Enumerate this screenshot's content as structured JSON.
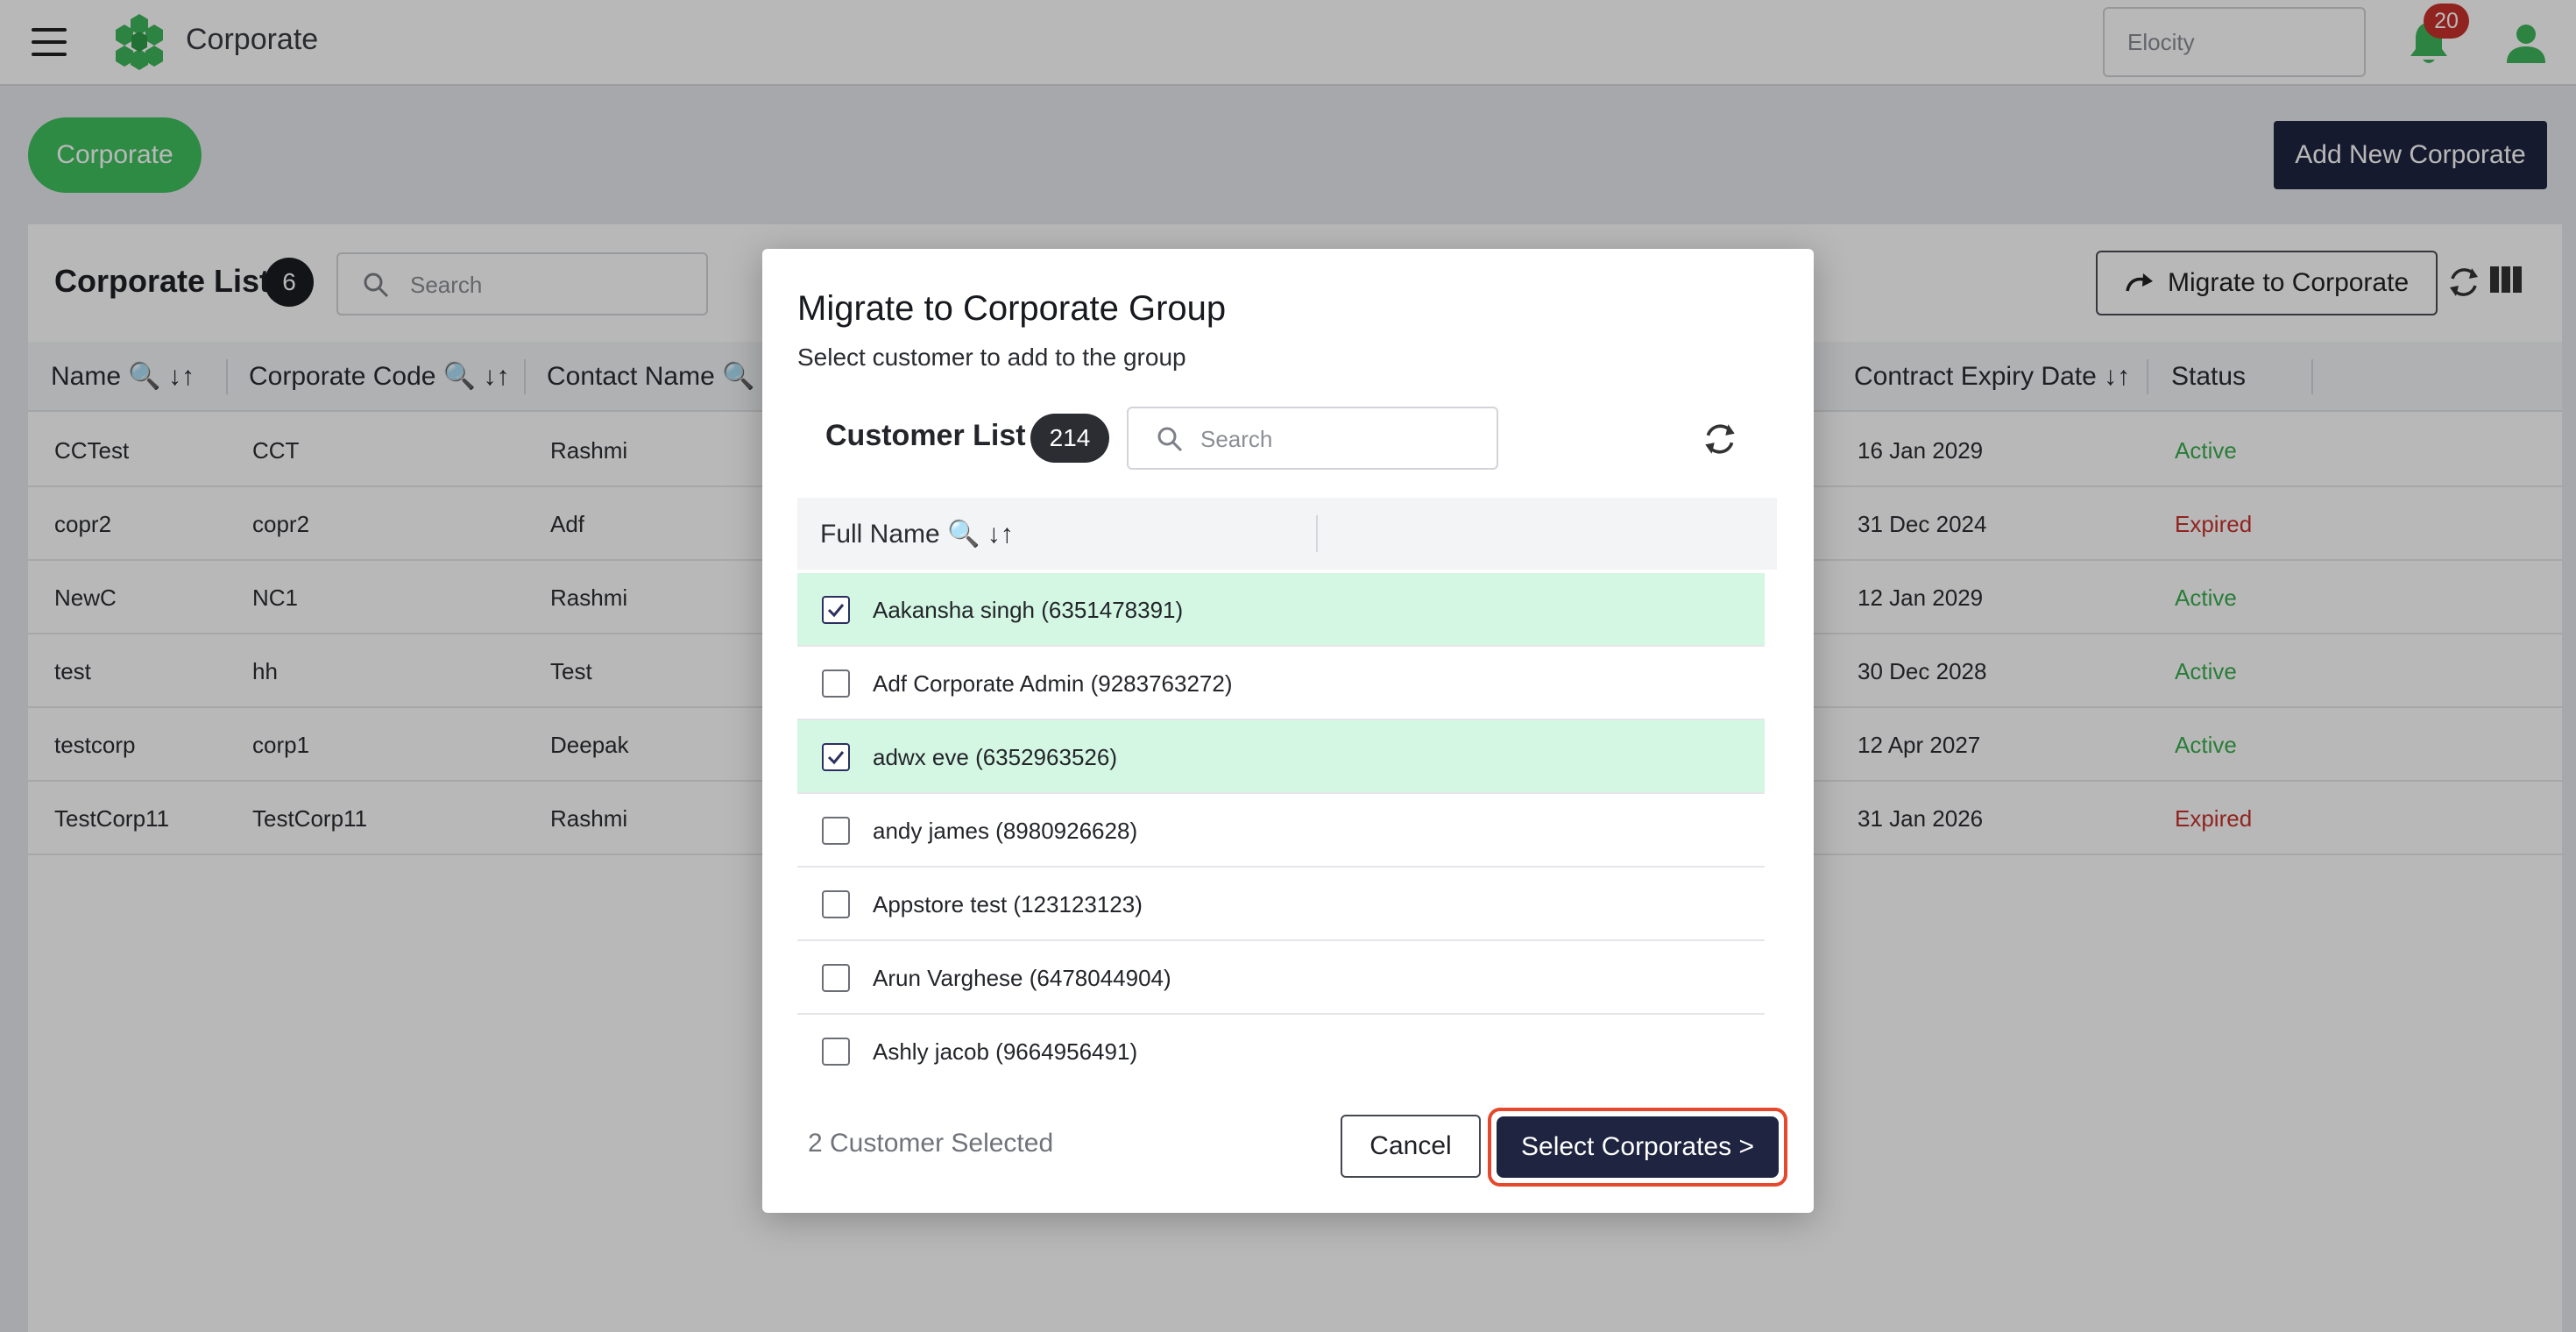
{
  "topbar": {
    "app_title": "Corporate",
    "tenant": "Elocity",
    "notification_count": "20"
  },
  "header": {
    "pill_label": "Corporate",
    "add_button": "Add New Corporate"
  },
  "corporate_list": {
    "title": "Corporate List",
    "count": "6",
    "search_placeholder": "Search",
    "migrate_button": "Migrate to Corporate",
    "columns": [
      "Name 🔍 ↓↑",
      "Corporate Code 🔍 ↓↑",
      "Contact Name 🔍 ↓↑",
      "Contract Expiry Date ↓↑",
      "Status"
    ],
    "rows": [
      {
        "name": "CCTest",
        "code": "CCT",
        "contact": "Rashmi",
        "expiry": "16 Jan 2029",
        "status": "Active"
      },
      {
        "name": "copr2",
        "code": "copr2",
        "contact": "Adf",
        "expiry": "31 Dec 2024",
        "status": "Expired"
      },
      {
        "name": "NewC",
        "code": "NC1",
        "contact": "Rashmi",
        "expiry": "12 Jan 2029",
        "status": "Active"
      },
      {
        "name": "test",
        "code": "hh",
        "contact": "Test",
        "expiry": "30 Dec 2028",
        "status": "Active"
      },
      {
        "name": "testcorp",
        "code": "corp1",
        "contact": "Deepak",
        "expiry": "12 Apr 2027",
        "status": "Active"
      },
      {
        "name": "TestCorp11",
        "code": "TestCorp11",
        "contact": "Rashmi",
        "expiry": "31 Jan 2026",
        "status": "Expired"
      }
    ]
  },
  "modal": {
    "title": "Migrate to Corporate Group",
    "subtitle": "Select customer to add to the group",
    "customer_list_title": "Customer List",
    "customer_count": "214",
    "search_placeholder": "Search",
    "column_header": "Full Name 🔍 ↓↑",
    "customers": [
      {
        "label": "Aakansha singh (6351478391)",
        "checked": true
      },
      {
        "label": "Adf Corporate Admin (9283763272)",
        "checked": false
      },
      {
        "label": "adwx eve (6352963526)",
        "checked": true
      },
      {
        "label": "andy james (8980926628)",
        "checked": false
      },
      {
        "label": "Appstore test (123123123)",
        "checked": false
      },
      {
        "label": "Arun Varghese (6478044904)",
        "checked": false
      },
      {
        "label": "Ashly jacob (9664956491)",
        "checked": false
      }
    ],
    "selected_text": "2 Customer Selected",
    "cancel_button": "Cancel",
    "select_button": "Select Corporates >"
  },
  "colors": {
    "accent_green": "#3fc15f",
    "navy": "#1f2440",
    "active": "#3aae4e",
    "expired": "#c8312b",
    "selected_row": "#d4f7e4",
    "highlight_ring": "#e5482d"
  }
}
